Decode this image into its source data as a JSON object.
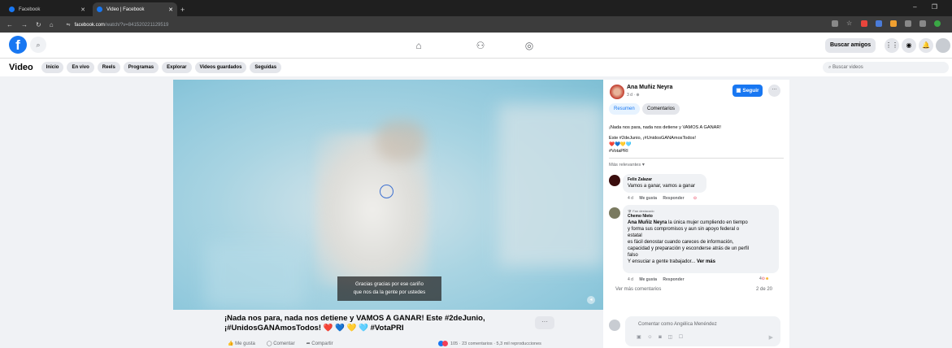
{
  "browser": {
    "tabs": [
      {
        "title": "Facebook"
      },
      {
        "title": "Video | Facebook"
      }
    ],
    "url_host": "facebook.com",
    "url_path": "/watch/?v=841520221129519",
    "window_controls": "–  ❐"
  },
  "header": {
    "logo": "f",
    "find_friends": "Buscar amigos"
  },
  "subnav": {
    "title": "Video",
    "pills": [
      "Inicio",
      "En vivo",
      "Reels",
      "Programas",
      "Explorar",
      "Videos guardados",
      "Seguidas"
    ],
    "search_placeholder": "Buscar videos"
  },
  "video": {
    "caption_line1": "Gracias gracias por ese cariño",
    "caption_line2": "que nos da la gente por ustedes",
    "title": "¡Nada nos para, nada nos detiene y VAMOS A GANAR! Este #2deJunio, ¡#UnidosGANAmosTodos! ❤️ 💙 💛 🩵 #VotaPRI",
    "more": "···",
    "actions": {
      "like": "Me gusta",
      "comment": "Comentar",
      "share": "Compartir"
    },
    "stats": "105 · 23 comentarios · 5,3 mil reproducciones"
  },
  "panel": {
    "author": "Ana Muñiz Neyra",
    "date": "3 d · ⊕",
    "follow": "Seguir",
    "more": "···",
    "tabs": [
      "Resumen",
      "Comentarios"
    ],
    "post_line1": "¡Nada nos para, nada nos detiene y VAMOS A GANAR!",
    "post_line2": "Este #2deJunio, ¡#UnidosGANAmosTodos!",
    "post_line3": "❤️💙💛🩵",
    "post_line4": "#VotaPRI",
    "relevance": "Más relevantes ▾",
    "comments": [
      {
        "name": "Felix Zalazar",
        "text": "Vamos a ganar, vamos a ganar",
        "meta_time": "4 d",
        "like": "Me gusta",
        "reply": "Responder"
      },
      {
        "badge": "🛡 Fan destacado",
        "name": "Chemo Nieto",
        "mention": "Ana Muñiz Neyra",
        "lines": [
          "la única mujer cumpliendo en tiempo",
          "y forma sus compromisos y aun sin apoyo federal o",
          "estatal",
          "es fácil denostar cuando careces de información,",
          "capacidad y preparación y esconderse atrás de un perfil",
          "falso",
          "Y ensuciar a gente trabajador..."
        ],
        "see_more": "Ver más",
        "meta_time": "4 d",
        "like": "Me gusta",
        "reply": "Responder",
        "reactions": "4"
      }
    ],
    "more_comments": "Ver más comentarios",
    "count": "2 de 20",
    "composer_placeholder": "Comentar como Angélica Menéndez"
  }
}
